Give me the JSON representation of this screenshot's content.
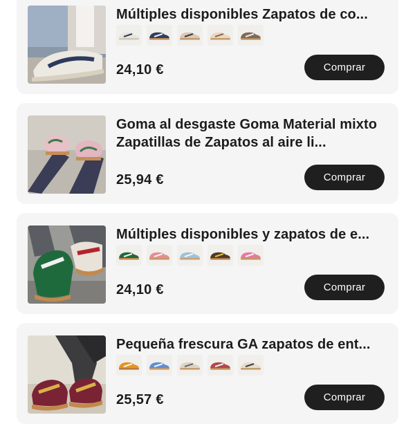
{
  "products": [
    {
      "title": "Múltiples disponibles Zapatos de co...",
      "price": "24,10 €",
      "button": "Comprar",
      "image": "sneaker-photo-white-navy",
      "swatches": [
        {
          "base": "#e9e6df",
          "stripe": "#2d3a5c",
          "sole": "#cfc8b8"
        },
        {
          "base": "#2f3d62",
          "stripe": "#f3f3f3",
          "sole": "#b88a5a"
        },
        {
          "base": "#d8c9b9",
          "stripe": "#3b3b3b",
          "sole": "#c49a6c"
        },
        {
          "base": "#e8d9c6",
          "stripe": "#8b6a4a",
          "sole": "#c79b6a"
        },
        {
          "base": "#7d6a5b",
          "stripe": "#ededed",
          "sole": "#b48a5e"
        }
      ]
    },
    {
      "title": "Goma al desgaste Goma Material mixto Zapatillas de Zapatos al aire li...",
      "price": "25,94 €",
      "button": "Comprar",
      "image": "sneaker-photo-floral-pink",
      "swatches": []
    },
    {
      "title": "Múltiples disponibles y zapatos de e...",
      "price": "24,10 €",
      "button": "Comprar",
      "image": "sneaker-photo-green-red",
      "swatches": [
        {
          "base": "#1f6a3c",
          "stripe": "#f2f2f2",
          "sole": "#c18a4e"
        },
        {
          "base": "#e78c95",
          "stripe": "#f3f3f3",
          "sole": "#c99563"
        },
        {
          "base": "#9cc3d9",
          "stripe": "#f6f6f6",
          "sole": "#c9a07a"
        },
        {
          "base": "#4b3a2a",
          "stripe": "#e8c336",
          "sole": "#b27d4c"
        },
        {
          "base": "#e47aa1",
          "stripe": "#f3f3f3",
          "sole": "#c99460"
        }
      ]
    },
    {
      "title": "Pequeña frescura GA zapatos de ent...",
      "price": "25,57 €",
      "button": "Comprar",
      "image": "sneaker-photo-burgundy-gold",
      "swatches": [
        {
          "base": "#e8941f",
          "stripe": "#f5f5f5",
          "sole": "#b9783b"
        },
        {
          "base": "#5d8fd6",
          "stripe": "#f5f5f5",
          "sole": "#c6976a"
        },
        {
          "base": "#ddd3c3",
          "stripe": "#6b6b6b",
          "sole": "#c59c6e"
        },
        {
          "base": "#b2474c",
          "stripe": "#f3f3f3",
          "sole": "#c08a5a"
        },
        {
          "base": "#e8dccd",
          "stripe": "#3d3d3d",
          "sole": "#c49b6d"
        }
      ]
    }
  ]
}
